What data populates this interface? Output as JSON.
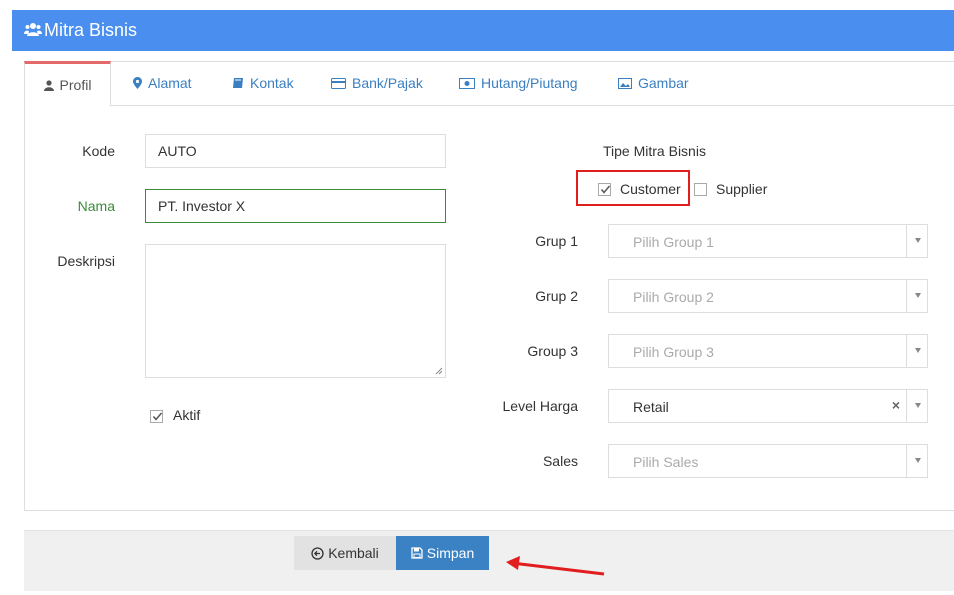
{
  "header": {
    "title": "Mitra Bisnis",
    "icon": "users-icon"
  },
  "tabs": [
    {
      "label": "Profil",
      "icon": "user-icon",
      "active": true
    },
    {
      "label": "Alamat",
      "icon": "map-marker-icon"
    },
    {
      "label": "Kontak",
      "icon": "book-icon"
    },
    {
      "label": "Bank/Pajak",
      "icon": "credit-card-icon"
    },
    {
      "label": "Hutang/Piutang",
      "icon": "money-icon"
    },
    {
      "label": "Gambar",
      "icon": "image-icon"
    }
  ],
  "form": {
    "kode_label": "Kode",
    "kode_value": "AUTO",
    "nama_label": "Nama",
    "nama_value": "PT. Investor X",
    "deskripsi_label": "Deskripsi",
    "deskripsi_value": "",
    "aktif_label": "Aktif",
    "aktif_checked": true
  },
  "tipe": {
    "label": "Tipe Mitra Bisnis",
    "customer_label": "Customer",
    "customer_checked": true,
    "supplier_label": "Supplier",
    "supplier_checked": false
  },
  "selects": {
    "grup1_label": "Grup 1",
    "grup1_placeholder": "Pilih Group 1",
    "grup2_label": "Grup 2",
    "grup2_placeholder": "Pilih Group 2",
    "group3_label": "Group 3",
    "group3_placeholder": "Pilih Group 3",
    "level_label": "Level Harga",
    "level_value": "Retail",
    "level_clear": "×",
    "sales_label": "Sales",
    "sales_placeholder": "Pilih Sales"
  },
  "footer": {
    "back_label": "Kembali",
    "save_label": "Simpan"
  },
  "colors": {
    "header_bg": "#4a8ff0",
    "accent_tab": "#e46a6a",
    "save_btn": "#3a82c4",
    "highlight": "#e11d1d",
    "valid_green": "#3b8b3b"
  }
}
